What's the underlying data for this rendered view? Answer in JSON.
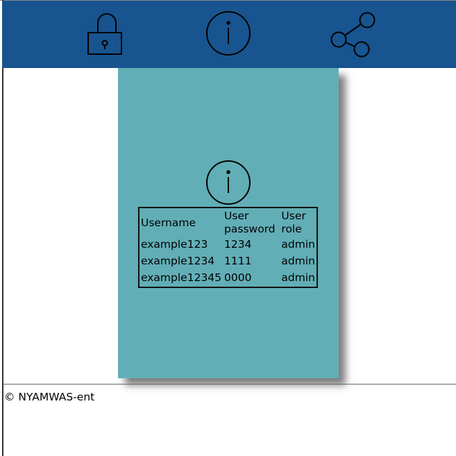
{
  "header": {
    "background": "#18548f",
    "icons": [
      "lock-icon",
      "info-icon",
      "share-icon"
    ]
  },
  "card": {
    "background": "#62aeb6",
    "icon": "info-icon",
    "table": {
      "columns": [
        "Username",
        "User password",
        "User role"
      ],
      "rows": [
        [
          "example123",
          "1234",
          "admin"
        ],
        [
          "example1234",
          "1111",
          "admin"
        ],
        [
          "example12345",
          "0000",
          "admin"
        ]
      ]
    }
  },
  "footer": {
    "copyright": "© NYAMWAS-ent"
  }
}
